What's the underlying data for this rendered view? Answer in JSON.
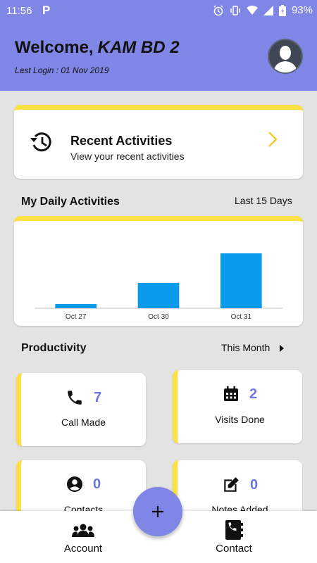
{
  "status_bar": {
    "time": "11:56",
    "app_icon": "P",
    "battery": "93%"
  },
  "header": {
    "welcome": "Welcome,",
    "user_name": "KAM BD 2",
    "last_login": "Last Login : 01 Nov 2019"
  },
  "recent": {
    "title": "Recent Activities",
    "subtitle": "View your recent activities"
  },
  "daily": {
    "title": "My Daily Activities",
    "range": "Last 15 Days"
  },
  "chart_data": {
    "type": "bar",
    "categories": [
      "Oct 27",
      "Oct 30",
      "Oct 31"
    ],
    "values": [
      1,
      6,
      13
    ],
    "ylim": [
      0,
      14
    ],
    "grid": false,
    "color": "#0a9bea"
  },
  "productivity": {
    "title": "Productivity",
    "period": "This Month"
  },
  "stats": [
    {
      "value": "7",
      "label": "Call Made",
      "icon": "phone-icon"
    },
    {
      "value": "2",
      "label": "Visits Done",
      "icon": "calendar-icon"
    },
    {
      "value": "0",
      "label": "Contacts",
      "icon": "user-circle-icon"
    },
    {
      "value": "0",
      "label": "Notes Added",
      "icon": "edit-note-icon"
    }
  ],
  "bottom_nav": {
    "account": "Account",
    "contact": "Contact"
  },
  "colors": {
    "header": "#7f86e6",
    "accent_yellow": "#fbe046",
    "bar": "#0a9bea",
    "number": "#6e76e0"
  }
}
